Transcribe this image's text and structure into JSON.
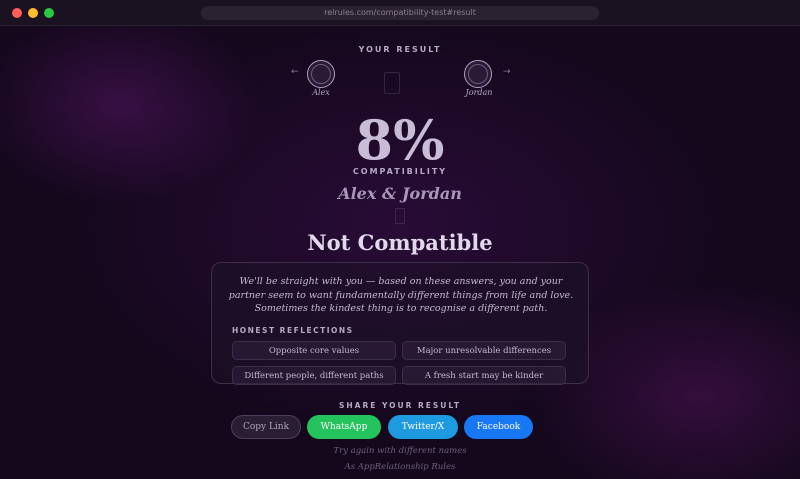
{
  "browser": {
    "url": "relrules.com/compatibility-test#result"
  },
  "result": {
    "heading": "YOUR RESULT",
    "arrow_left": "←",
    "arrow_right": "→",
    "person_left": "Alex",
    "person_right": "Jordan",
    "percentage": "8%",
    "percentage_label": "COMPATIBILITY",
    "couple": "Alex & Jordan",
    "verdict": "Not Compatible",
    "description": "We'll be straight with you — based on these answers, you and your partner seem to want fundamentally different things from life and love. Sometimes the kindest thing is to recognise a different path.",
    "reflections_title": "HONEST REFLECTIONS",
    "reflections": [
      "Opposite core values",
      "Major unresolvable differences",
      "Different people, different paths",
      "A fresh start may be kinder"
    ],
    "icon_names": [
      "heart-icon",
      "broken-heart-icon"
    ]
  },
  "share": {
    "title": "SHARE YOUR RESULT",
    "buttons": {
      "copy": "Copy Link",
      "whatsapp": "WhatsApp",
      "twitter": "Twitter/X",
      "facebook": "Facebook"
    },
    "colors": {
      "whatsapp": "#25c35e",
      "twitter": "#1e9ae0",
      "facebook": "#1877f2"
    }
  },
  "try_again": "Try again with different names",
  "footer": "As AppRelationship Rules"
}
